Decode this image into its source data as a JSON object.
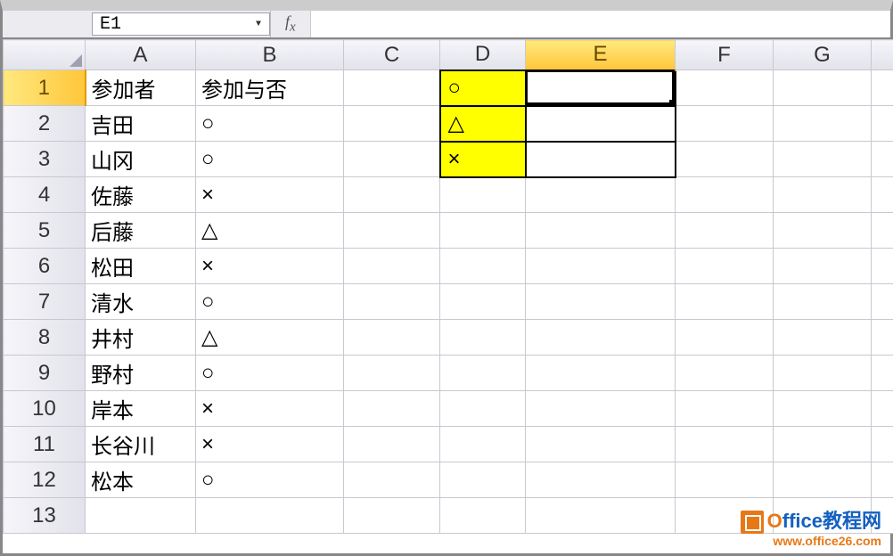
{
  "name_box": "E1",
  "formula_value": "",
  "columns": [
    "A",
    "B",
    "C",
    "D",
    "E",
    "F",
    "G",
    ""
  ],
  "active_column_index": 4,
  "active_row_index": 0,
  "row_headers": [
    "1",
    "2",
    "3",
    "4",
    "5",
    "6",
    "7",
    "8",
    "9",
    "10",
    "11",
    "12",
    "13"
  ],
  "cells": {
    "A1": "参加者",
    "B1": "参加与否",
    "A2": "吉田",
    "B2": "○",
    "A3": "山冈",
    "B3": "○",
    "A4": "佐藤",
    "B4": "×",
    "A5": "后藤",
    "B5": "△",
    "A6": "松田",
    "B6": "×",
    "A7": "清水",
    "B7": "○",
    "A8": "井村",
    "B8": "△",
    "A9": "野村",
    "B9": "○",
    "A10": "岸本",
    "B10": "×",
    "A11": "长谷川",
    "B11": "×",
    "A12": "松本",
    "B12": "○",
    "D1": "○",
    "D2": "△",
    "D3": "×"
  },
  "watermark": {
    "brand_first": "O",
    "brand_rest": "ffice教程网",
    "url": "www.office26.com"
  }
}
